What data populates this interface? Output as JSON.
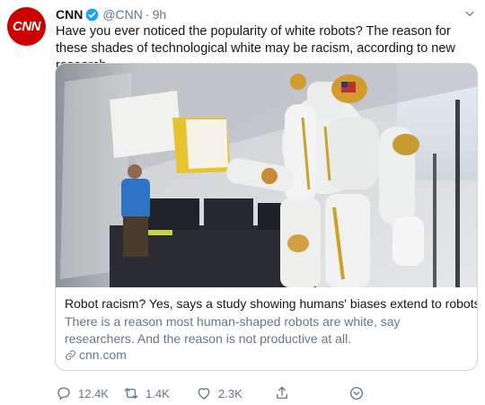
{
  "author": {
    "name": "CNN",
    "handle": "@CNN",
    "separator": "·",
    "time": "9h",
    "avatar_text": "CNN"
  },
  "tweet_text": "Have you ever noticed the popularity of white robots? The reason for these shades of technological white may be racism, according to new research.",
  "card": {
    "title": "Robot racism? Yes, says a study showing humans' biases extend to robots",
    "description": "There is a reason most human-shaped robots are white, say researchers. And the reason is not productive at all.",
    "domain": "cnn.com",
    "image_icon": "robot-photo"
  },
  "actions": {
    "replies": "12.4K",
    "retweets": "1.4K",
    "likes": "2.3K"
  },
  "icons": {
    "verified": "verified-badge-icon",
    "caret": "chevron-down-icon",
    "reply": "reply-icon",
    "retweet": "retweet-icon",
    "like": "heart-icon",
    "share": "share-icon",
    "bookmark": "bookmark-icon",
    "link": "link-icon"
  },
  "colors": {
    "brand": "#cc0000",
    "verified": "#1da1f2",
    "muted": "#657786",
    "text": "#14171a",
    "border": "#ccd6dd"
  }
}
